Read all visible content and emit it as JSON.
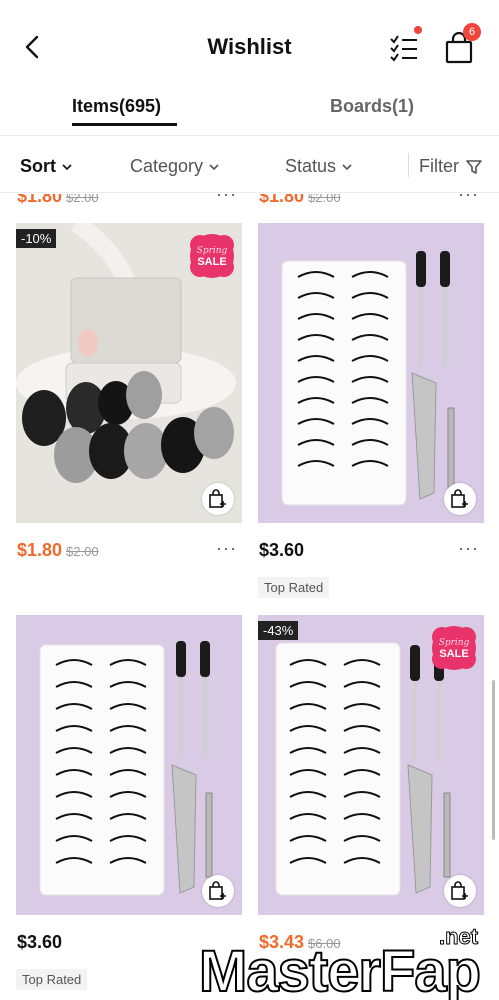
{
  "header": {
    "title": "Wishlist",
    "cart_count": "6",
    "icons": [
      "back-arrow-icon",
      "checklist-icon",
      "shopping-bag-icon"
    ]
  },
  "tabs": [
    {
      "label": "Items(695)",
      "active": true
    },
    {
      "label": "Boards(1)",
      "active": false
    }
  ],
  "filters": {
    "sort": "Sort",
    "category": "Category",
    "status": "Status",
    "filter": "Filter"
  },
  "peek_row": [
    {
      "price": "$1.80",
      "old_price": "$2.00"
    },
    {
      "price": "$1.80",
      "old_price": "$2.00"
    }
  ],
  "products": [
    {
      "discount": "-10%",
      "promo": "Spring SALE",
      "price": "$1.80",
      "old_price": "$2.00",
      "tag": "",
      "image": "makeup-puffs"
    },
    {
      "discount": "",
      "promo": "",
      "price": "$3.60",
      "old_price": "",
      "tag": "Top Rated",
      "image": "eyelash-kit"
    },
    {
      "discount": "",
      "promo": "",
      "price": "$3.60",
      "old_price": "",
      "tag": "Top Rated",
      "image": "eyelash-kit"
    },
    {
      "discount": "-43%",
      "promo": "Spring SALE",
      "price": "$3.43",
      "old_price": "$6.00",
      "tag": "",
      "image": "eyelash-kit"
    }
  ],
  "more_label": "···",
  "watermark": {
    "text": "MasterFap",
    "suffix": ".net"
  },
  "colors": {
    "accent": "#f06a2e",
    "badge": "#f0453a",
    "lilac": "#d9cbe6"
  }
}
